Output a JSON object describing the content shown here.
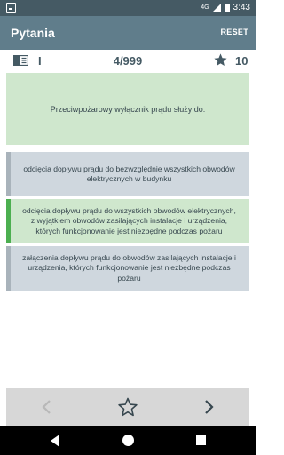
{
  "status_bar": {
    "time": "3:43",
    "network": "4G"
  },
  "app_bar": {
    "title": "Pytania",
    "reset_label": "RESET"
  },
  "info_bar": {
    "category": "I",
    "progress": "4/999",
    "score": "10"
  },
  "question": {
    "text": "Przeciwpożarowy wyłącznik prądu służy do:"
  },
  "answers": [
    {
      "text": "odcięcia dopływu prądu do bezwzględnie wszystkich obwodów elektrycznych w budynku",
      "state": "neutral"
    },
    {
      "text": "odcięcia dopływu prądu do wszystkich obwodów elektrycznych, z wyjątkiem obwodów zasilających instalacje i urządzenia, których funkcjonowanie jest niezbędne podczas pożaru",
      "state": "correct"
    },
    {
      "text": "załączenia dopływu prądu do obwodów zasilających instalacje i urządzenia, których funkcjonowanie jest niezbędne podczas pożaru",
      "state": "neutral"
    }
  ],
  "bottom_bar": {
    "prev_icon": "chevron-left-icon",
    "favorite_icon": "star-outline-icon",
    "next_icon": "chevron-right-icon"
  },
  "colors": {
    "status_bar": "#455a64",
    "app_bar": "#607d8b",
    "correct_bg": "#cfe7cd",
    "correct_accent": "#4caf50",
    "neutral_bg": "#cfd7de"
  }
}
